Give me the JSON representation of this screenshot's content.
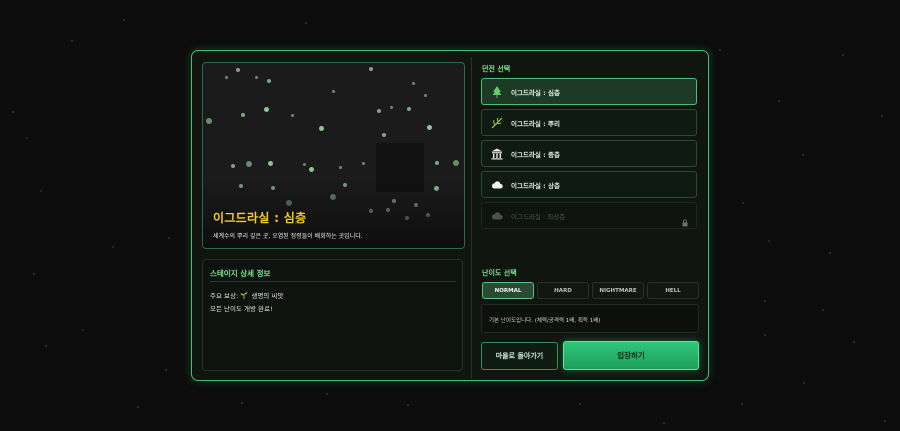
{
  "preview": {
    "dungeon_name": "이그드라실 : 심층",
    "dungeon_desc": "세계수의 뿌리 깊은 곳, 오염된 정령들이 배회하는 곳입니다."
  },
  "stage_detail": {
    "title": "스테이지 상세 정보",
    "reward_label": "주요 보상:",
    "reward_item": "생명의 씨앗",
    "note": "모든 난이도 개방 완료!"
  },
  "dungeon_select": {
    "title": "던전 선택",
    "items": [
      {
        "label": "이그드라실 : 심층",
        "icon": "tree-icon",
        "selected": true,
        "locked": false
      },
      {
        "label": "이그드라실 : 뿌리",
        "icon": "root-icon",
        "selected": false,
        "locked": false
      },
      {
        "label": "이그드라실 : 중층",
        "icon": "temple-icon",
        "selected": false,
        "locked": false
      },
      {
        "label": "이그드라실 : 상층",
        "icon": "cloud-icon",
        "selected": false,
        "locked": false
      },
      {
        "label": "이그드라실 : 최상층",
        "icon": "cloud-icon",
        "selected": false,
        "locked": true
      }
    ]
  },
  "difficulty": {
    "title": "난이도 선택",
    "options": [
      "NORMAL",
      "HARD",
      "NIGHTMARE",
      "HELL"
    ],
    "selected": "NORMAL",
    "description": "기본 난이도입니다. (체력/공격력 1배, 획득 1배)"
  },
  "buttons": {
    "back": "마을로 돌아가기",
    "enter": "입장하기"
  },
  "colors": {
    "accent": "#3fbf72",
    "title_gold": "#f0d020",
    "enter_button": "#2ec77a"
  }
}
